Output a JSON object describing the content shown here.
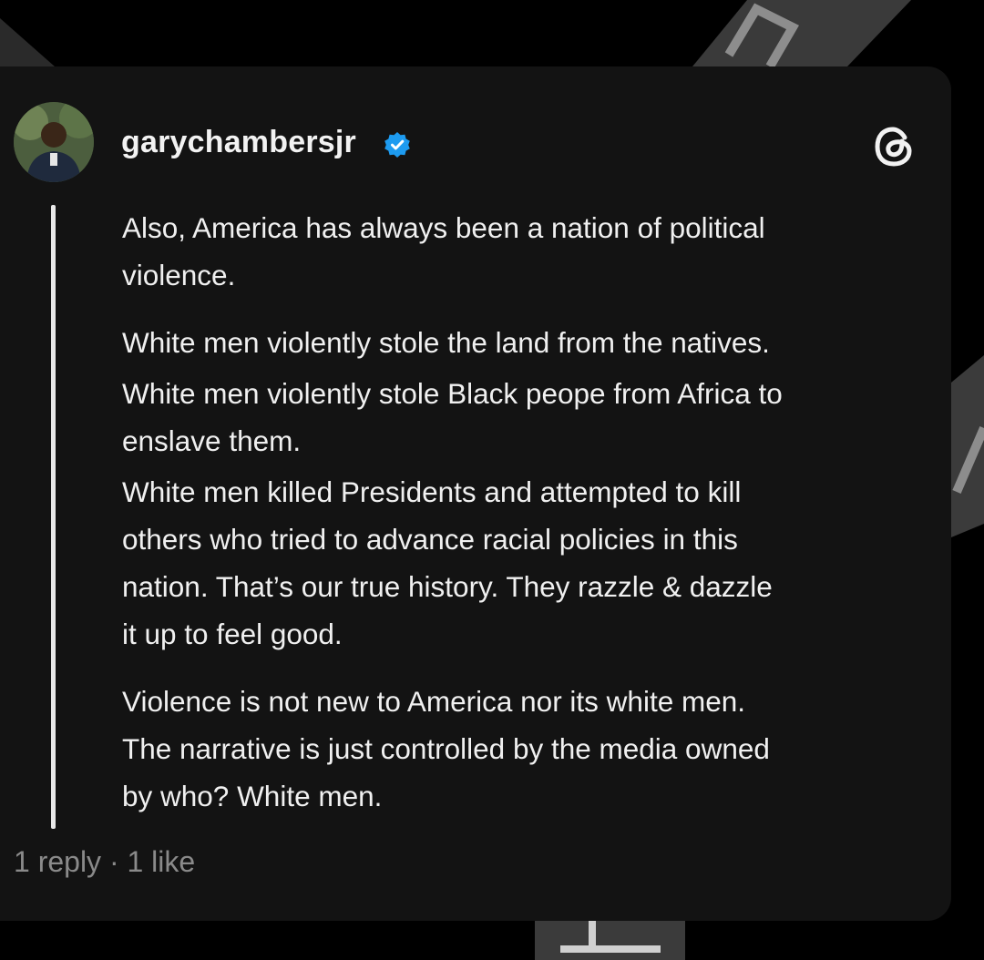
{
  "post": {
    "username": "garychambersjr",
    "verified": true,
    "paragraphs": [
      "Also, America has always been a nation of political\nviolence.",
      "White men violently stole the land from the natives.",
      "White men violently stole Black peope from Africa to\nenslave them.",
      "White men killed Presidents and attempted to kill\nothers who tried to advance racial policies in this\nnation. That’s our true history. They razzle & dazzle\nit up to feel good.",
      "Violence is not new to America nor its white men.\nThe narrative is just controlled by the media owned\nby who? White men."
    ],
    "meta": "1 reply · 1 like"
  },
  "icons": {
    "verified": "verified-badge-icon",
    "threads": "threads-logo-icon"
  },
  "colors": {
    "background": "#000000",
    "card": "#131313",
    "text": "#f0f0f0",
    "muted": "#8a8a8a",
    "verified": "#1d9bf0"
  }
}
